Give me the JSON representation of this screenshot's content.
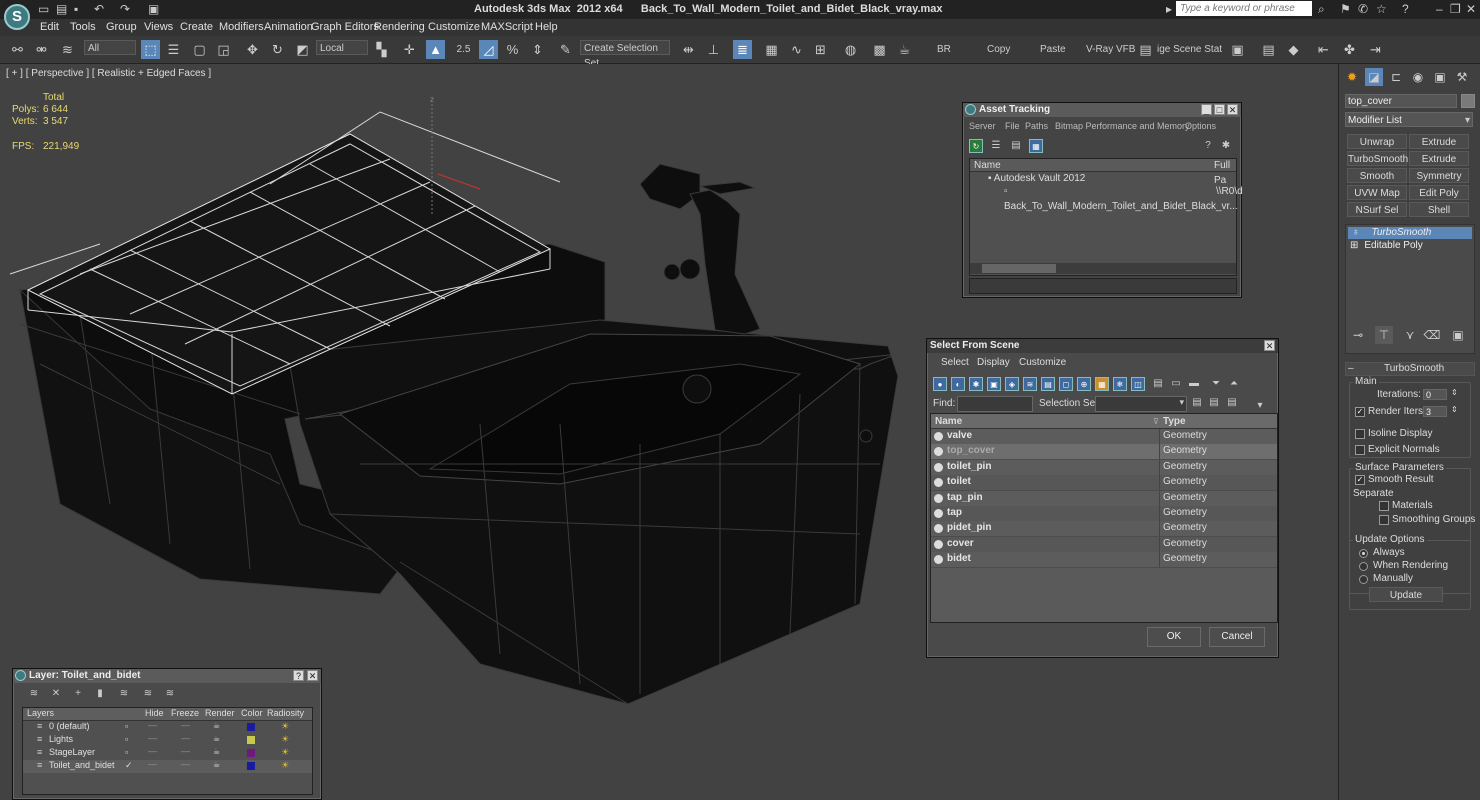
{
  "titlebar": {
    "app_title": "Autodesk 3ds Max  2012 x64",
    "file_name": "Back_To_Wall_Modern_Toilet_and_Bidet_Black_vray.max",
    "search_placeholder": "Type a keyword or phrase"
  },
  "menu": [
    "Edit",
    "Tools",
    "Group",
    "Views",
    "Create",
    "Modifiers",
    "Animation",
    "Graph Editors",
    "Rendering",
    "Customize",
    "MAXScript",
    "Help"
  ],
  "toolbar": {
    "selection_filter": "All",
    "coord_system": "Local",
    "snap_angle": "2.5",
    "named_selection": "Create Selection Set",
    "br_label": "BR",
    "copy_label": "Copy",
    "paste_label": "Paste",
    "vray_label": "V-Ray VFB",
    "scene_state_label": "ige Scene Stat"
  },
  "viewport": {
    "label": "[ + ] [ Perspective ] [ Realistic + Edged Faces ]",
    "stats": {
      "total_label": "Total",
      "polys_label": "Polys:",
      "polys_value": "6 644",
      "verts_label": "Verts:",
      "verts_value": "3 547",
      "fps_label": "FPS:",
      "fps_value": "221,949"
    },
    "axis_label": "z"
  },
  "asset_tracking": {
    "title": "Asset Tracking",
    "menu": [
      "Server",
      "File",
      "Paths",
      "Bitmap Performance and Memory",
      "Options"
    ],
    "col_name": "Name",
    "col_path": "Full Pa",
    "rows": [
      "Autodesk Vault 2012",
      "Back_To_Wall_Modern_Toilet_and_Bidet_Black_vr..."
    ],
    "row_path": "\\\\R0\\d"
  },
  "select_from_scene": {
    "title": "Select From Scene",
    "menu": [
      "Select",
      "Display",
      "Customize"
    ],
    "find_label": "Find:",
    "selection_set_label": "Selection Set:",
    "col_name": "Name",
    "col_type": "Type",
    "rows": [
      {
        "name": "valve",
        "type": "Geometry"
      },
      {
        "name": "top_cover",
        "type": "Geometry"
      },
      {
        "name": "toilet_pin",
        "type": "Geometry"
      },
      {
        "name": "toilet",
        "type": "Geometry"
      },
      {
        "name": "tap_pin",
        "type": "Geometry"
      },
      {
        "name": "tap",
        "type": "Geometry"
      },
      {
        "name": "pidet_pin",
        "type": "Geometry"
      },
      {
        "name": "cover",
        "type": "Geometry"
      },
      {
        "name": "bidet",
        "type": "Geometry"
      }
    ],
    "ok_label": "OK",
    "cancel_label": "Cancel"
  },
  "layer_manager": {
    "title": "Layer: Toilet_and_bidet",
    "help": "?",
    "cols": [
      "Layers",
      "Hide",
      "Freeze",
      "Render",
      "Color",
      "Radiosity"
    ],
    "layers": [
      {
        "name": "0 (default)",
        "color": "#1a1aa0"
      },
      {
        "name": "Lights",
        "color": "#c8c850"
      },
      {
        "name": "StageLayer",
        "color": "#701880"
      },
      {
        "name": "Toilet_and_bidet",
        "color": "#1a1aa0"
      }
    ]
  },
  "command_panel": {
    "object_name": "top_cover",
    "modifier_list": "Modifier List",
    "buttons": [
      [
        "Unwrap UVW",
        "Extrude"
      ],
      [
        "TurboSmooth",
        "Extrude"
      ],
      [
        "Smooth",
        "Symmetry"
      ],
      [
        "UVW Map",
        "Edit Poly"
      ],
      [
        "NSurf Sel",
        "Shell"
      ]
    ],
    "stack": [
      "TurboSmooth",
      "Editable Poly"
    ],
    "rollout_title": "TurboSmooth",
    "main_label": "Main",
    "iterations_label": "Iterations:",
    "iterations_value": "0",
    "render_iters_label": "Render Iters:",
    "render_iters_value": "3",
    "isoline_label": "Isoline Display",
    "explicit_normals_label": "Explicit Normals",
    "surface_params_label": "Surface Parameters",
    "smooth_result_label": "Smooth Result",
    "separate_label": "Separate",
    "materials_label": "Materials",
    "smoothing_groups_label": "Smoothing Groups",
    "update_options_label": "Update Options",
    "always_label": "Always",
    "when_rendering_label": "When Rendering",
    "manually_label": "Manually",
    "update_label": "Update"
  }
}
